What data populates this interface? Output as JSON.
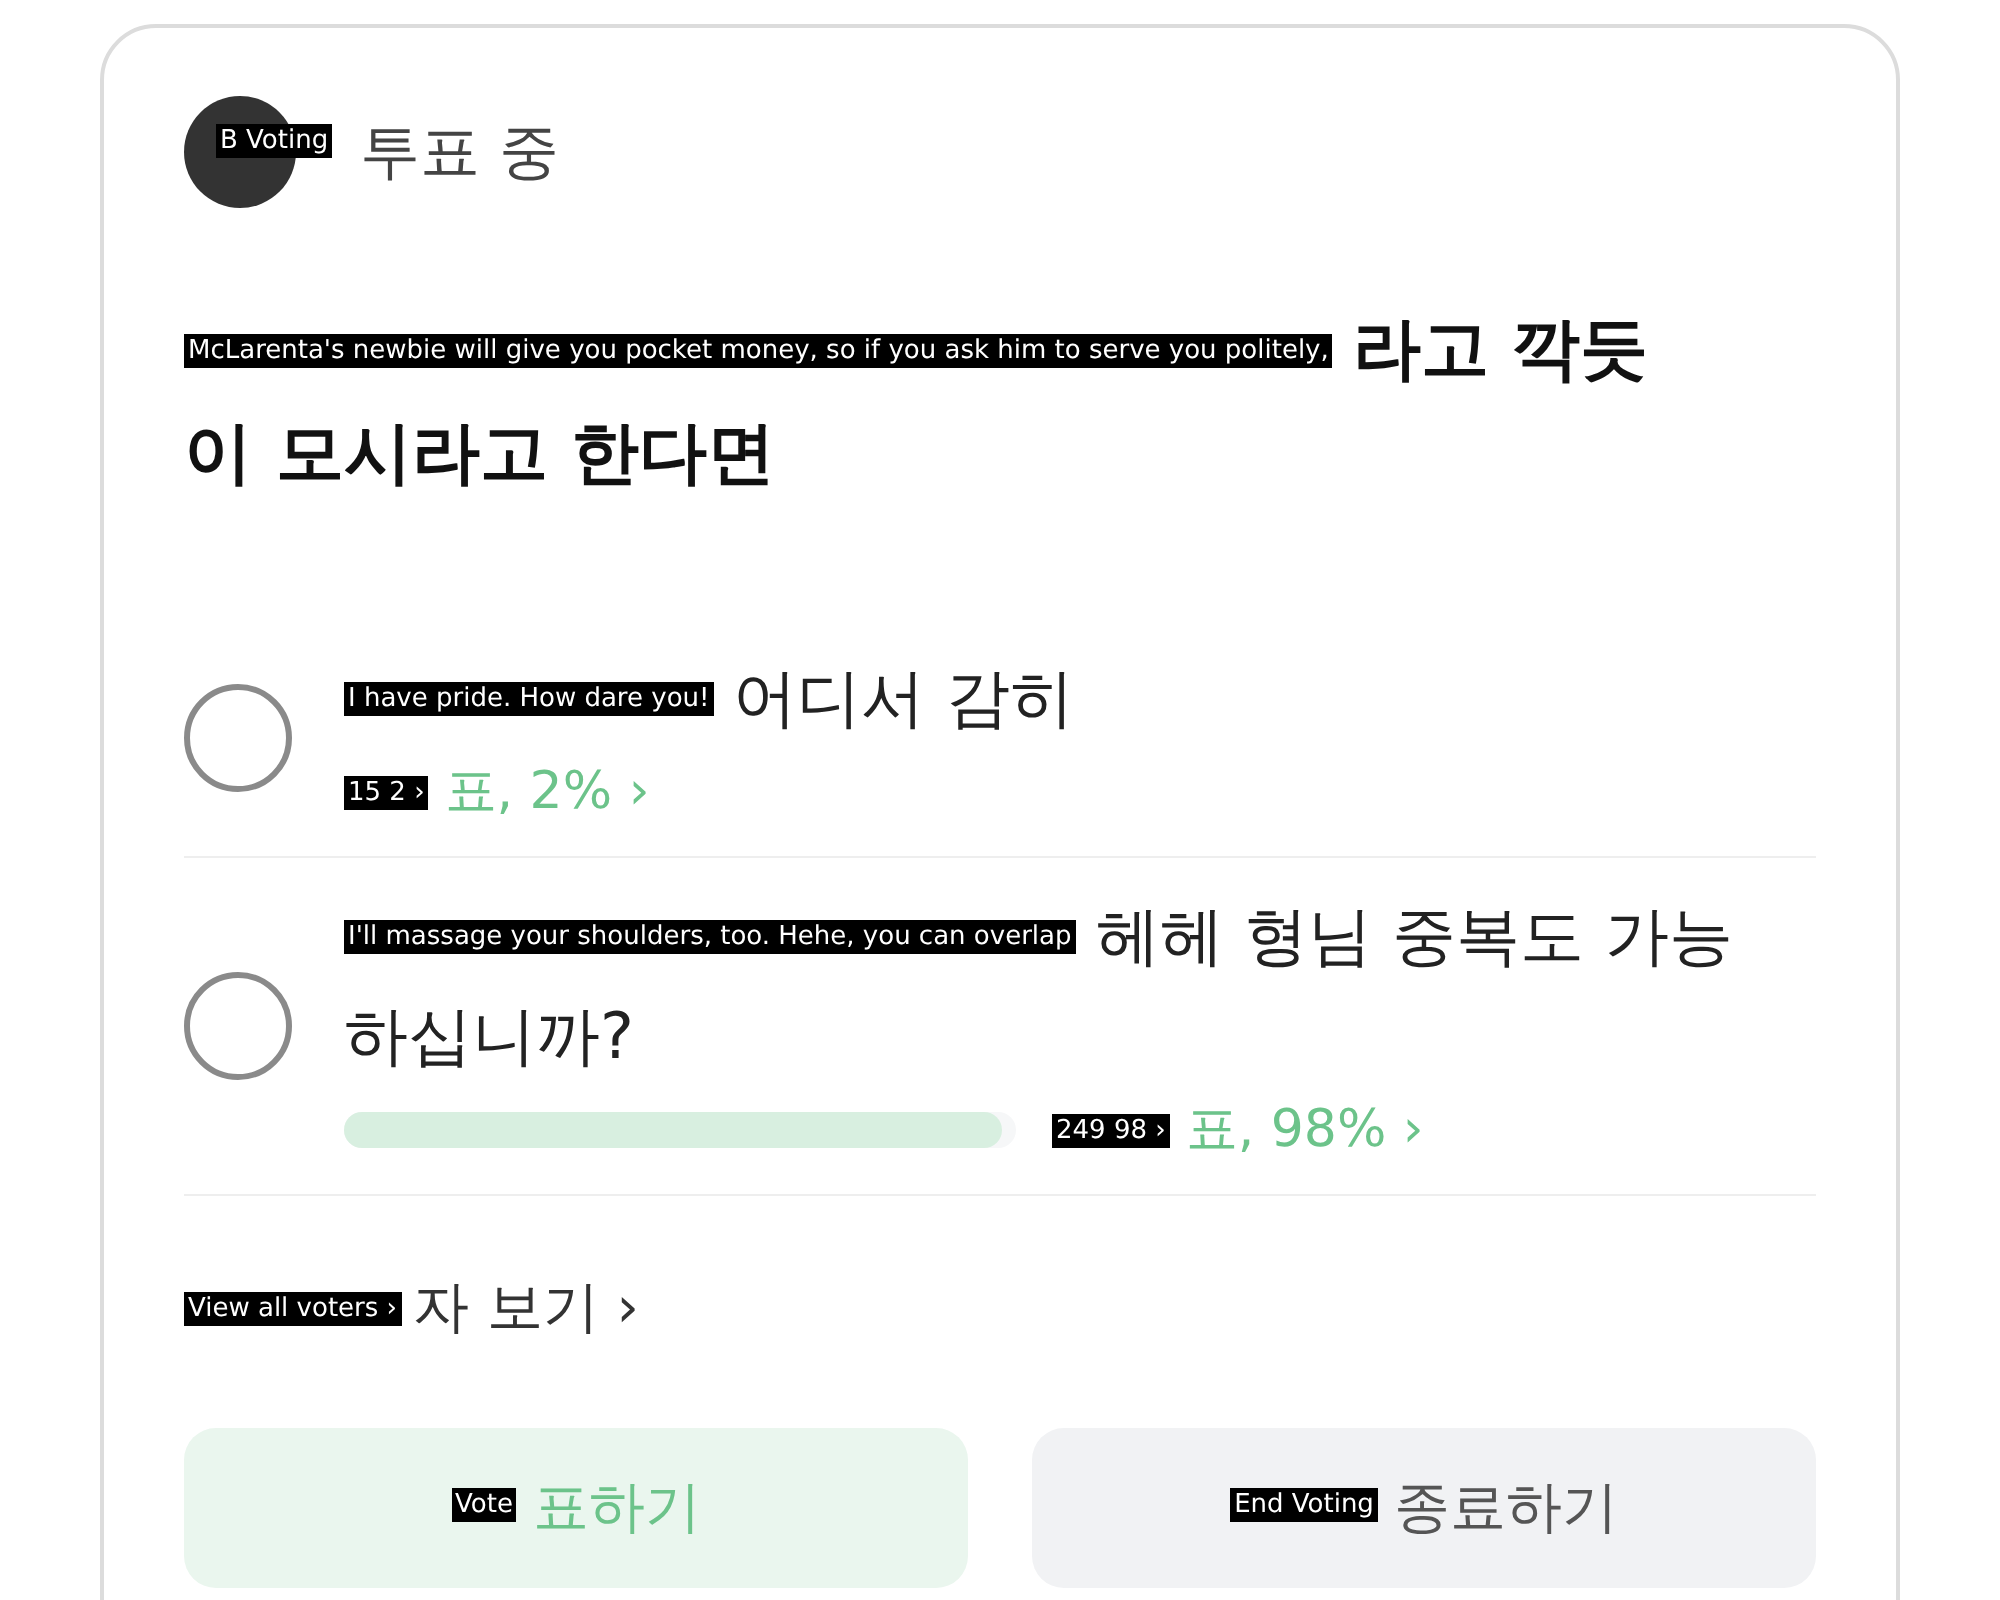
{
  "header": {
    "avatar_tag": "B Voting",
    "status": "투표 중"
  },
  "question": {
    "tag": "McLarenta's newbie will give you pocket money, so if you ask him to serve you politely,",
    "line_1": "라고 깍듯",
    "line_2": "이 모시라고 한다면"
  },
  "options": [
    {
      "selected": false,
      "tag": "I have pride. How dare you!",
      "lines": [
        "어디서 감히"
      ],
      "result_tag": "15 2 ›",
      "result": "표, 2% ›"
    },
    {
      "selected": false,
      "tag": "I'll massage your shoulders, too. Hehe, you can overlap",
      "lines": [
        "헤헤 형님 중복도 가능",
        "하십니까?"
      ],
      "level": 0.98,
      "result_tag": "249 98 ›",
      "result": "표, 98% ›"
    }
  ],
  "voters_link": {
    "tag": "View all voters ›",
    "text": "자 보기 ›"
  },
  "buttons": [
    {
      "kind": "primary",
      "tag": "Vote",
      "text": "표하기"
    },
    {
      "kind": "secondary",
      "tag": "End Voting",
      "text": "종료하기"
    }
  ]
}
